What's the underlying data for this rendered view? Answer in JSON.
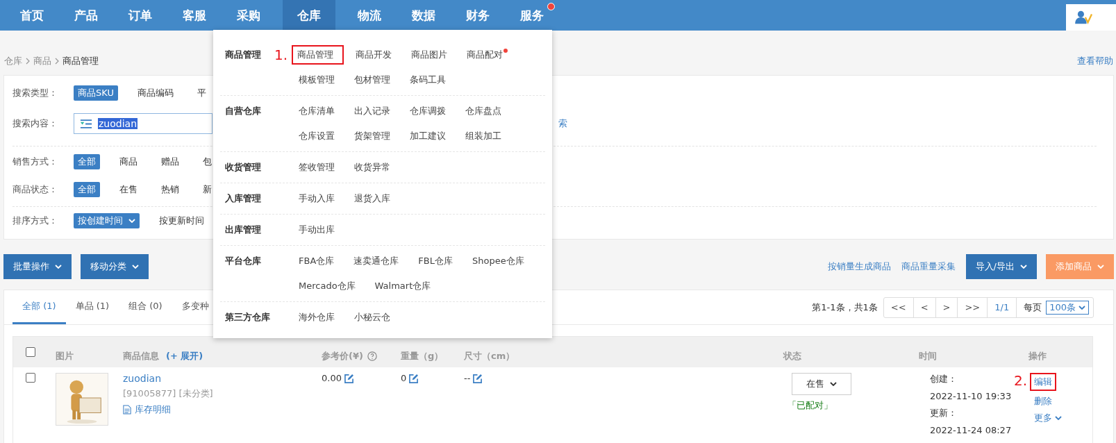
{
  "nav": {
    "items": [
      {
        "label": "首页",
        "selected": false,
        "dot": false
      },
      {
        "label": "产品",
        "selected": false,
        "dot": false
      },
      {
        "label": "订单",
        "selected": false,
        "dot": false
      },
      {
        "label": "客服",
        "selected": false,
        "dot": false
      },
      {
        "label": "采购",
        "selected": false,
        "dot": false
      },
      {
        "label": "仓库",
        "selected": true,
        "dot": false
      },
      {
        "label": "物流",
        "selected": false,
        "dot": false
      },
      {
        "label": "数据",
        "selected": false,
        "dot": false
      },
      {
        "label": "财务",
        "selected": false,
        "dot": false
      },
      {
        "label": "服务",
        "selected": false,
        "dot": true
      }
    ]
  },
  "breadcrumb": [
    "仓库",
    "商品",
    "商品管理"
  ],
  "help_link": "查看帮助",
  "filters": {
    "search_type": {
      "label": "搜索类型：",
      "options": [
        {
          "label": "商品SKU",
          "selected": true
        },
        {
          "label": "商品编码",
          "selected": false
        },
        {
          "label": "平",
          "selected": false
        }
      ]
    },
    "search_content": {
      "label": "搜索内容：",
      "value": "zuodian",
      "link": "索"
    },
    "sales": {
      "label": "销售方式：",
      "options": [
        {
          "label": "全部",
          "selected": true
        },
        {
          "label": "商品",
          "selected": false
        },
        {
          "label": "赠品",
          "selected": false
        },
        {
          "label": "包",
          "selected": false
        }
      ]
    },
    "status": {
      "label": "商品状态：",
      "options": [
        {
          "label": "全部",
          "selected": true
        },
        {
          "label": "在售",
          "selected": false
        },
        {
          "label": "热销",
          "selected": false
        },
        {
          "label": "新",
          "selected": false
        }
      ]
    },
    "sort": {
      "label": "排序方式：",
      "options": [
        {
          "label": "按创建时间",
          "selected": true
        },
        {
          "label": "按更新时间",
          "selected": false
        }
      ]
    }
  },
  "toolbar": {
    "left_buttons": [
      "批量操作",
      "移动分类"
    ],
    "links": [
      "按销量生成商品",
      "商品重量采集"
    ],
    "right_buttons": [
      {
        "label": "导入/导出",
        "kind": "primary"
      },
      {
        "label": "添加商品",
        "kind": "accent"
      }
    ]
  },
  "tabs": [
    {
      "label": "全部 (1)",
      "selected": true
    },
    {
      "label": "单品 (1)",
      "selected": false
    },
    {
      "label": "组合 (0)",
      "selected": false
    },
    {
      "label": "多变种",
      "selected": false
    }
  ],
  "pagination": {
    "summary": "第1-1条，共1条",
    "buttons": [
      {
        "label": "<<",
        "selected": false
      },
      {
        "label": "<",
        "selected": false
      },
      {
        "label": ">",
        "selected": false
      },
      {
        "label": ">>",
        "selected": false
      },
      {
        "label": "1/1",
        "selected": true
      }
    ],
    "per_page_label": "每页",
    "per_page": "100条"
  },
  "table": {
    "columns": [
      {
        "kind": "checkbox",
        "checked": false
      },
      {
        "kind": "text",
        "label": "图片"
      },
      {
        "kind": "expand",
        "label": "商品信息",
        "link": "(+ 展开)"
      },
      {
        "kind": "help",
        "label": "参考价(¥)"
      },
      {
        "kind": "text",
        "label": "重量（g）"
      },
      {
        "kind": "text",
        "label": "尺寸（cm）"
      },
      {
        "kind": "text",
        "label": "状态"
      },
      {
        "kind": "text",
        "label": "时间"
      },
      {
        "kind": "text",
        "label": "操作"
      }
    ],
    "rows": [
      {
        "checked": false,
        "picture": {
          "kind": "picture"
        },
        "name": "zuodian",
        "meta": "[91005877] [未分类]",
        "stock_link": "库存明细",
        "price": "0.00",
        "weight": "0",
        "size": "--",
        "status": "在售",
        "pair": "「已配对」",
        "created_label": "创建：",
        "created": "2022-11-10 19:33",
        "updated_label": "更新：",
        "updated": "2022-11-24 08:27",
        "actions": [
          {
            "label": "编辑",
            "kind": "link",
            "boxed": true,
            "annotation": "2."
          },
          {
            "label": "删除",
            "kind": "link",
            "boxed": false
          },
          {
            "label": "更多",
            "kind": "dropdown",
            "boxed": false
          }
        ]
      }
    ]
  },
  "menu": {
    "sections": [
      {
        "heading": "商品管理",
        "rows": [
          [
            {
              "label": "商品管理",
              "boxed": true,
              "annotation": "1.",
              "dot": false
            },
            {
              "label": "商品开发",
              "boxed": false,
              "dot": false
            },
            {
              "label": "商品图片",
              "boxed": false,
              "dot": false
            },
            {
              "label": "商品配对",
              "boxed": false,
              "dot": true
            }
          ],
          [
            {
              "label": "模板管理",
              "boxed": false,
              "dot": false
            },
            {
              "label": "包材管理",
              "boxed": false,
              "dot": false
            },
            {
              "label": "条码工具",
              "boxed": false,
              "dot": false
            }
          ]
        ]
      },
      {
        "heading": "自营仓库",
        "rows": [
          [
            {
              "label": "仓库清单",
              "boxed": false,
              "dot": false
            },
            {
              "label": "出入记录",
              "boxed": false,
              "dot": false
            },
            {
              "label": "仓库调拨",
              "boxed": false,
              "dot": false
            },
            {
              "label": "仓库盘点",
              "boxed": false,
              "dot": false
            }
          ],
          [
            {
              "label": "仓库设置",
              "boxed": false,
              "dot": false
            },
            {
              "label": "货架管理",
              "boxed": false,
              "dot": false
            },
            {
              "label": "加工建议",
              "boxed": false,
              "dot": false
            },
            {
              "label": "组装加工",
              "boxed": false,
              "dot": false
            }
          ]
        ]
      },
      {
        "heading": "收货管理",
        "rows": [
          [
            {
              "label": "签收管理",
              "boxed": false,
              "dot": false
            },
            {
              "label": "收货异常",
              "boxed": false,
              "dot": false
            }
          ]
        ]
      },
      {
        "heading": "入库管理",
        "rows": [
          [
            {
              "label": "手动入库",
              "boxed": false,
              "dot": false
            },
            {
              "label": "退货入库",
              "boxed": false,
              "dot": false
            }
          ]
        ]
      },
      {
        "heading": "出库管理",
        "rows": [
          [
            {
              "label": "手动出库",
              "boxed": false,
              "dot": false
            }
          ]
        ]
      },
      {
        "heading": "平台仓库",
        "rows": [
          [
            {
              "label": "FBA仓库",
              "boxed": false,
              "dot": false
            },
            {
              "label": "速卖通仓库",
              "boxed": false,
              "dot": false
            },
            {
              "label": "FBL仓库",
              "boxed": false,
              "dot": false
            },
            {
              "label": "Shopee仓库",
              "boxed": false,
              "dot": false
            }
          ],
          [
            {
              "label": "Mercado仓库",
              "boxed": false,
              "dot": false
            },
            {
              "label": "Walmart仓库",
              "boxed": false,
              "dot": false
            }
          ]
        ]
      },
      {
        "heading": "第三方仓库",
        "rows": [
          [
            {
              "label": "海外仓库",
              "boxed": false,
              "dot": false
            },
            {
              "label": "小秘云仓",
              "boxed": false,
              "dot": false
            }
          ]
        ]
      }
    ]
  }
}
